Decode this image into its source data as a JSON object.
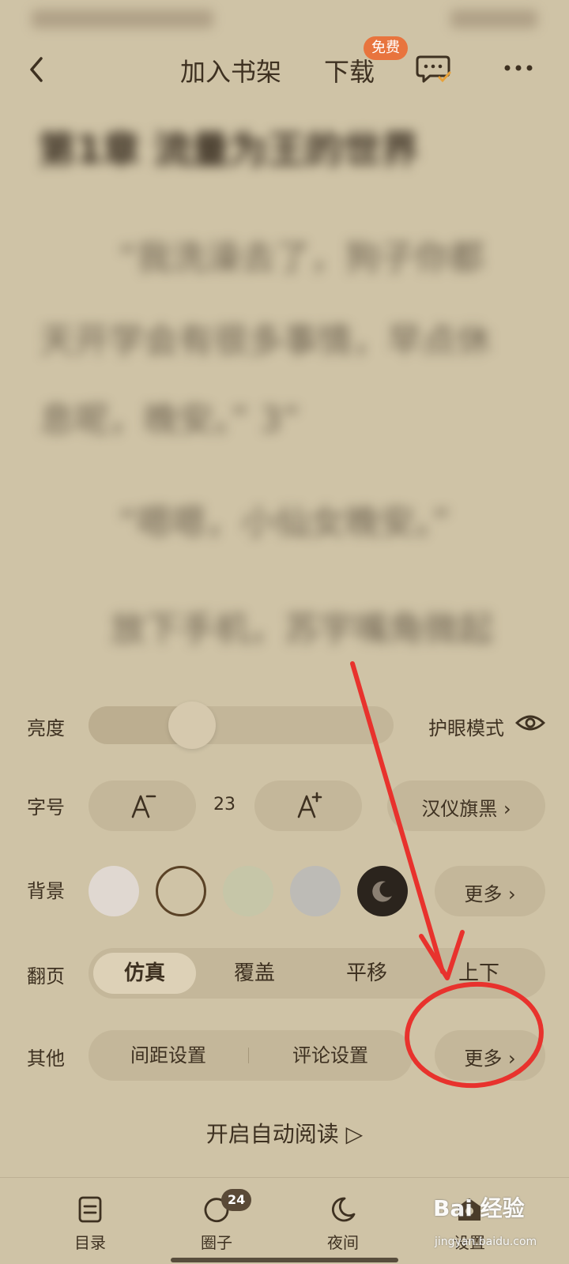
{
  "reader": {
    "chapter_title": "第1章 流量为王的世界",
    "paragraphs": [
      "“我洗澡去了，狗子你都",
      "天开学会有很多事情，早点休",
      "息呢，晚安。” 3”",
      "“嗯嗯，小仙女晚安。”",
      "放下手机，苏宇嘴角微起"
    ]
  },
  "top_bar": {
    "back_icon": "chevron-left-icon",
    "add_to_shelf": "加入书架",
    "download": "下载",
    "free_badge": "免费",
    "comment_icon": "comment-check-icon",
    "more_icon": "ellipsis-icon"
  },
  "settings": {
    "brightness": {
      "label": "亮度",
      "level": 0.31,
      "eye_mode_label": "护眼模式",
      "eye_icon": "eye-icon"
    },
    "font": {
      "label": "字号",
      "decrease_icon": "font-decrease-icon",
      "size": "23",
      "increase_icon": "font-increase-icon",
      "face": "汉仪旗黑 ›"
    },
    "background": {
      "label": "背景",
      "swatches": [
        {
          "color": "#e0d8d1",
          "name": "light-gray"
        },
        {
          "color": "#cfc3a6",
          "name": "parchment",
          "selected": true
        },
        {
          "color": "#c6c6a8",
          "name": "green-tint"
        },
        {
          "color": "#bdbbb6",
          "name": "blue-gray"
        },
        {
          "color": "#2b241d",
          "name": "night",
          "icon": "moon-icon"
        }
      ],
      "more": "更多 ›"
    },
    "page_turn": {
      "label": "翻页",
      "options": [
        "仿真",
        "覆盖",
        "平移",
        "上下"
      ],
      "selected": "仿真"
    },
    "other": {
      "label": "其他",
      "spacing": "间距设置",
      "comments": "评论设置",
      "more": "更多 ›"
    },
    "auto_read": "开启自动阅读 ▷"
  },
  "bottom_nav": {
    "items": [
      {
        "label": "目录",
        "icon": "toc-icon"
      },
      {
        "label": "圈子",
        "icon": "circle-icon",
        "badge": "24"
      },
      {
        "label": "夜间",
        "icon": "moon-icon"
      },
      {
        "label": "设置",
        "icon": "settings-icon"
      }
    ]
  },
  "annotation": {
    "color": "#e8322d"
  },
  "watermark": {
    "text": "Bai 经验",
    "sub": "jingyan.baidu.com"
  },
  "colors": {
    "panel_bg": "#cfc3a6",
    "pill_bg": "#c4b79a",
    "text": "#3e3121",
    "badge": "#e8743e"
  }
}
